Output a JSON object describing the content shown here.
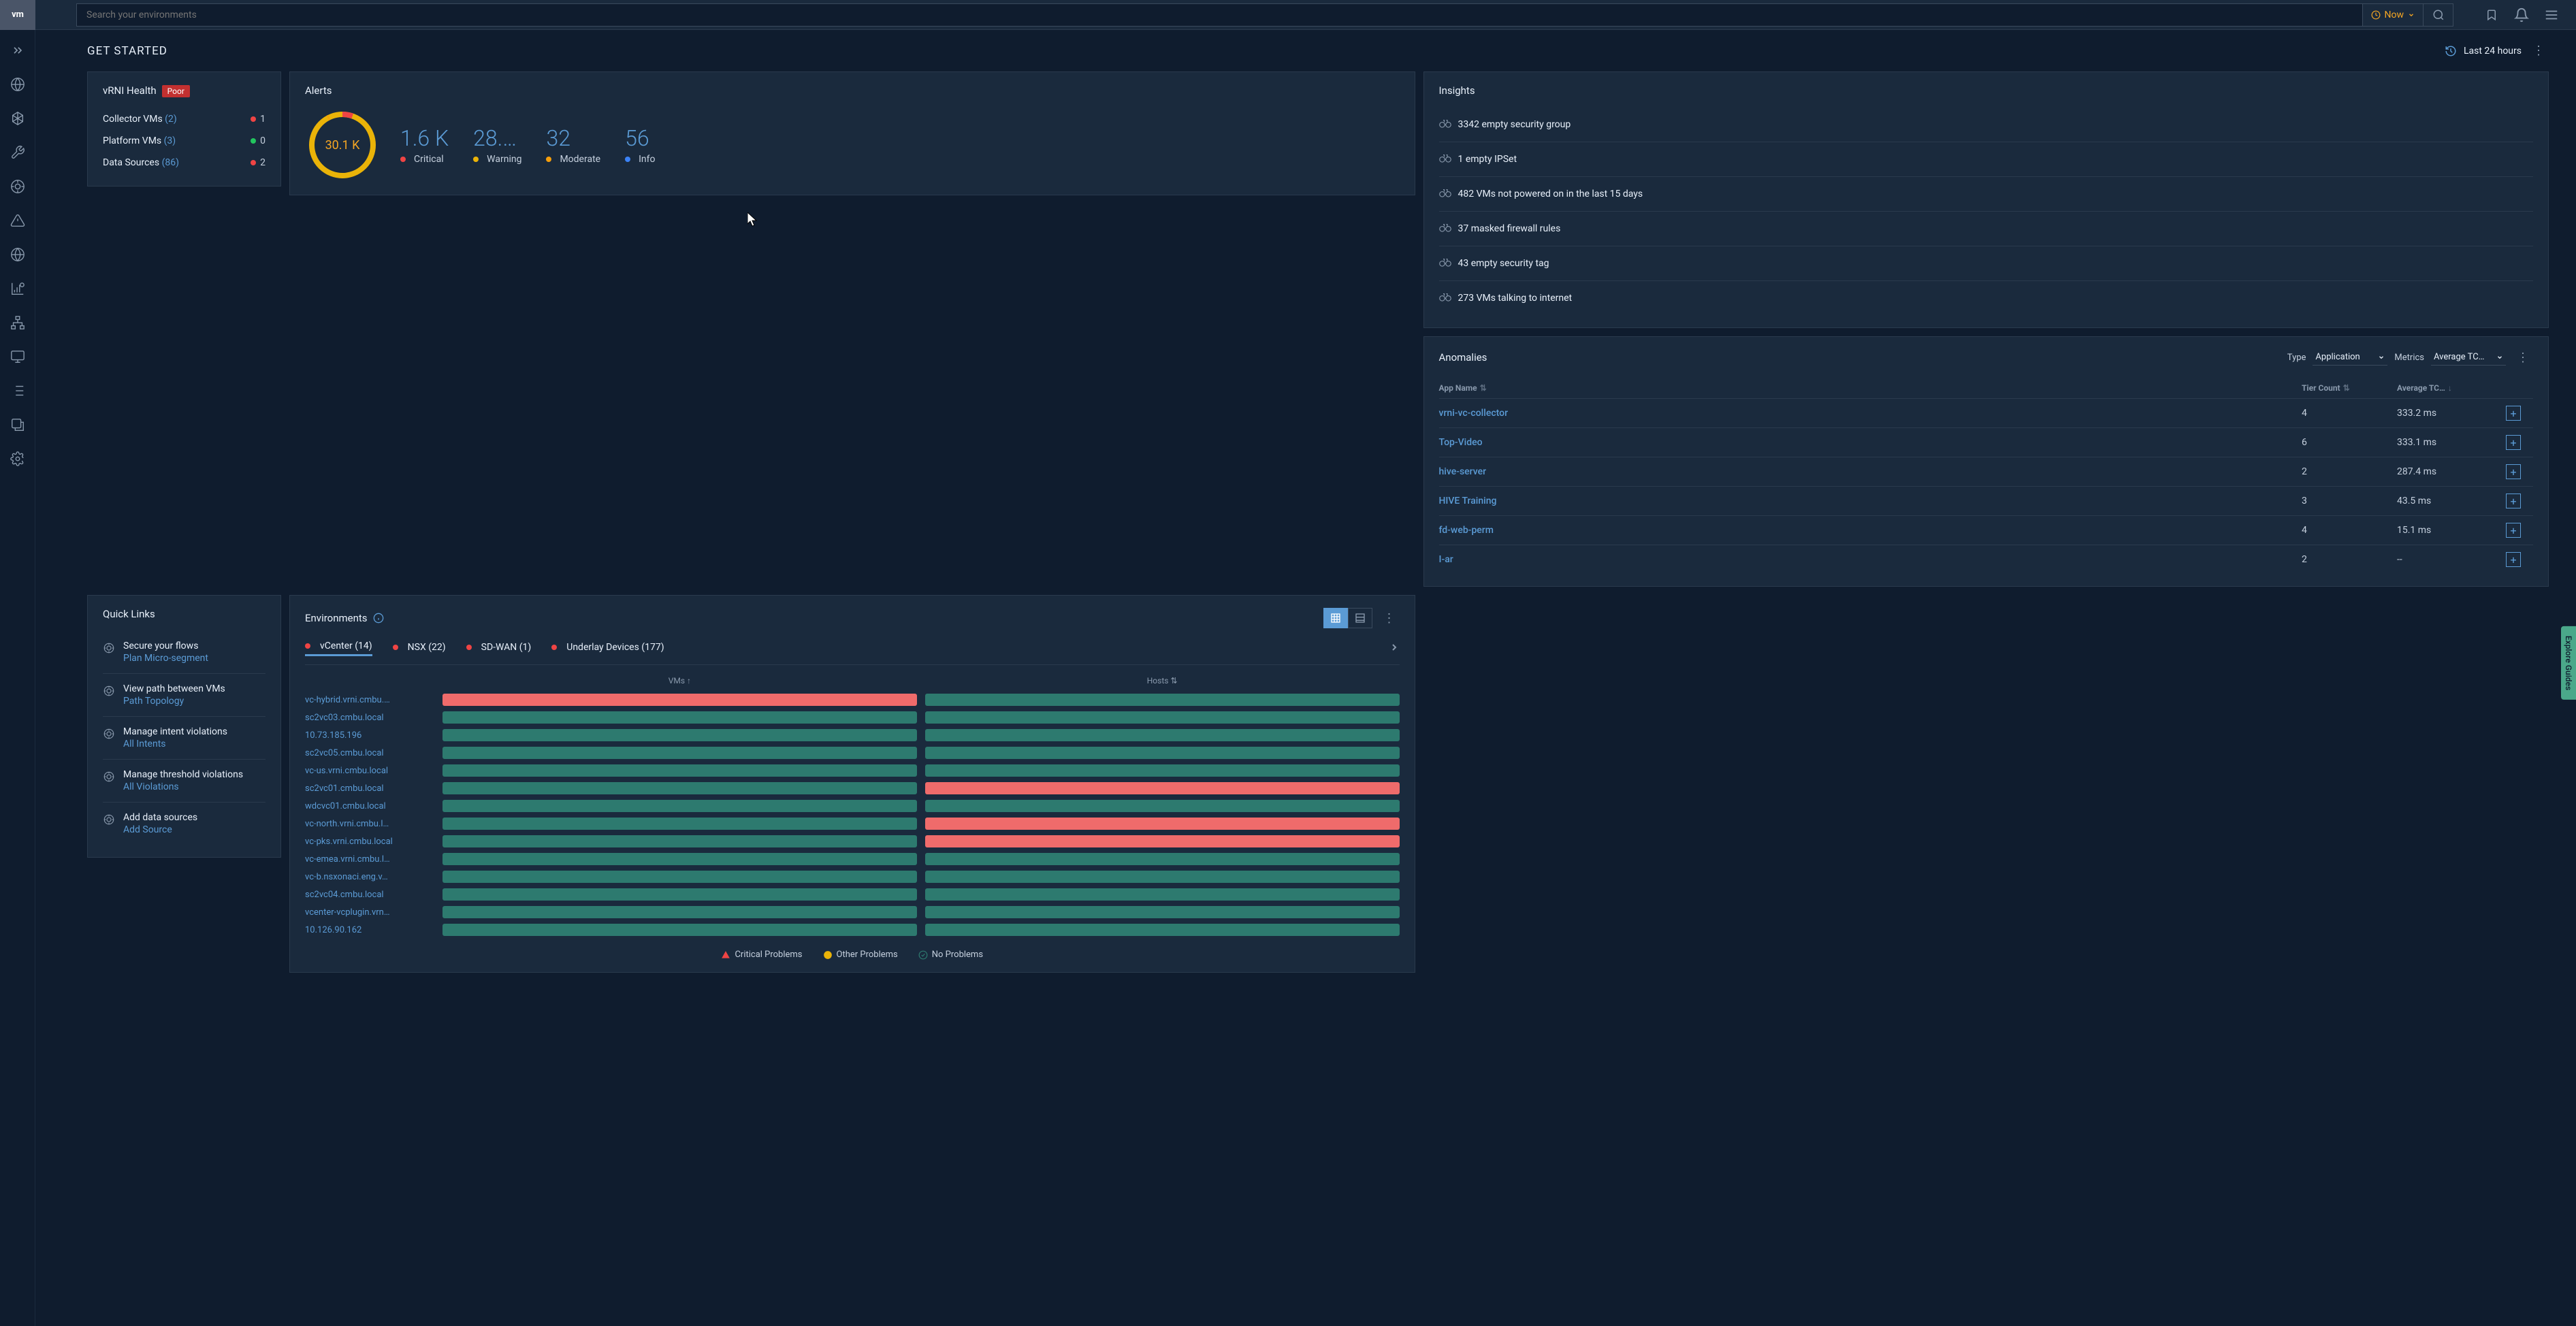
{
  "logo": "vm",
  "search": {
    "placeholder": "Search your environments"
  },
  "now_button": "Now",
  "page_title": "GET STARTED",
  "time_range": "Last 24 hours",
  "health": {
    "title": "vRNI Health",
    "badge": "Poor",
    "rows": [
      {
        "label": "Collector VMs",
        "count": "(2)",
        "dot": "red",
        "value": "1"
      },
      {
        "label": "Platform VMs",
        "count": "(3)",
        "dot": "green",
        "value": "0"
      },
      {
        "label": "Data Sources",
        "count": "(86)",
        "dot": "red",
        "value": "2"
      }
    ]
  },
  "alerts": {
    "title": "Alerts",
    "total": "30.1 K",
    "stats": [
      {
        "value": "1.6 K",
        "label": "Critical",
        "dot": "red"
      },
      {
        "value": "28.…",
        "label": "Warning",
        "dot": "yellow"
      },
      {
        "value": "32",
        "label": "Moderate",
        "dot": "orange"
      },
      {
        "value": "56",
        "label": "Info",
        "dot": "blue"
      }
    ]
  },
  "quicklinks": {
    "title": "Quick Links",
    "items": [
      {
        "text": "Secure your flows",
        "link": "Plan Micro-segment"
      },
      {
        "text": "View path between VMs",
        "link": "Path Topology"
      },
      {
        "text": "Manage intent violations",
        "link": "All Intents"
      },
      {
        "text": "Manage threshold violations",
        "link": "All Violations"
      },
      {
        "text": "Add data sources",
        "link": "Add Source"
      }
    ]
  },
  "environments": {
    "title": "Environments",
    "tabs": [
      {
        "label": "vCenter (14)",
        "active": true
      },
      {
        "label": "NSX (22)"
      },
      {
        "label": "SD-WAN (1)"
      },
      {
        "label": "Underlay Devices (177)"
      }
    ],
    "col1": "VMs ↑",
    "col2": "Hosts ⇅",
    "rows": [
      {
        "name": "vc-hybrid.vrni.cmbu.…",
        "vm": "red",
        "host": "green"
      },
      {
        "name": "sc2vc03.cmbu.local",
        "vm": "green",
        "host": "green"
      },
      {
        "name": "10.73.185.196",
        "vm": "green",
        "host": "green"
      },
      {
        "name": "sc2vc05.cmbu.local",
        "vm": "green",
        "host": "green"
      },
      {
        "name": "vc-us.vrni.cmbu.local",
        "vm": "green",
        "host": "green"
      },
      {
        "name": "sc2vc01.cmbu.local",
        "vm": "green",
        "host": "red"
      },
      {
        "name": "wdcvc01.cmbu.local",
        "vm": "green",
        "host": "green"
      },
      {
        "name": "vc-north.vrni.cmbu.l…",
        "vm": "green",
        "host": "red"
      },
      {
        "name": "vc-pks.vrni.cmbu.local",
        "vm": "green",
        "host": "red"
      },
      {
        "name": "vc-emea.vrni.cmbu.l…",
        "vm": "green",
        "host": "green"
      },
      {
        "name": "vc-b.nsxonaci.eng.v…",
        "vm": "green",
        "host": "green"
      },
      {
        "name": "sc2vc04.cmbu.local",
        "vm": "green",
        "host": "green"
      },
      {
        "name": "vcenter-vcplugin.vrn…",
        "vm": "green",
        "host": "green"
      },
      {
        "name": "10.126.90.162",
        "vm": "green",
        "host": "green"
      }
    ],
    "legend": {
      "critical": "Critical Problems",
      "other": "Other Problems",
      "none": "No Problems"
    }
  },
  "insights": {
    "title": "Insights",
    "items": [
      "3342 empty security group",
      "1 empty IPSet",
      "482 VMs not powered on in the last 15 days",
      "37 masked firewall rules",
      "43 empty security tag",
      "273 VMs talking to internet"
    ]
  },
  "anomalies": {
    "title": "Anomalies",
    "type_label": "Type",
    "type_value": "Application",
    "metrics_label": "Metrics",
    "metrics_value": "Average TC…",
    "col_app": "App Name",
    "col_tier": "Tier Count",
    "col_avg": "Average TC…",
    "rows": [
      {
        "name": "vrni-vc-collector",
        "tier": "4",
        "avg": "333.2 ms"
      },
      {
        "name": "Top-Video",
        "tier": "6",
        "avg": "333.1 ms"
      },
      {
        "name": "hive-server",
        "tier": "2",
        "avg": "287.4 ms"
      },
      {
        "name": "HIVE Training",
        "tier": "3",
        "avg": "43.5 ms"
      },
      {
        "name": "fd-web-perm",
        "tier": "4",
        "avg": "15.1 ms"
      },
      {
        "name": "I-ar",
        "tier": "2",
        "avg": "--"
      }
    ]
  },
  "explore": "Explore Guides",
  "chart_data": {
    "type": "donut",
    "title": "Alerts",
    "total": "30.1 K",
    "series": [
      {
        "name": "Critical",
        "value": 1600,
        "color": "#ef4444"
      },
      {
        "name": "Warning",
        "value": 28400,
        "color": "#eab308"
      },
      {
        "name": "Moderate",
        "value": 32,
        "color": "#f59e0b"
      },
      {
        "name": "Info",
        "value": 56,
        "color": "#3b82f6"
      }
    ]
  }
}
